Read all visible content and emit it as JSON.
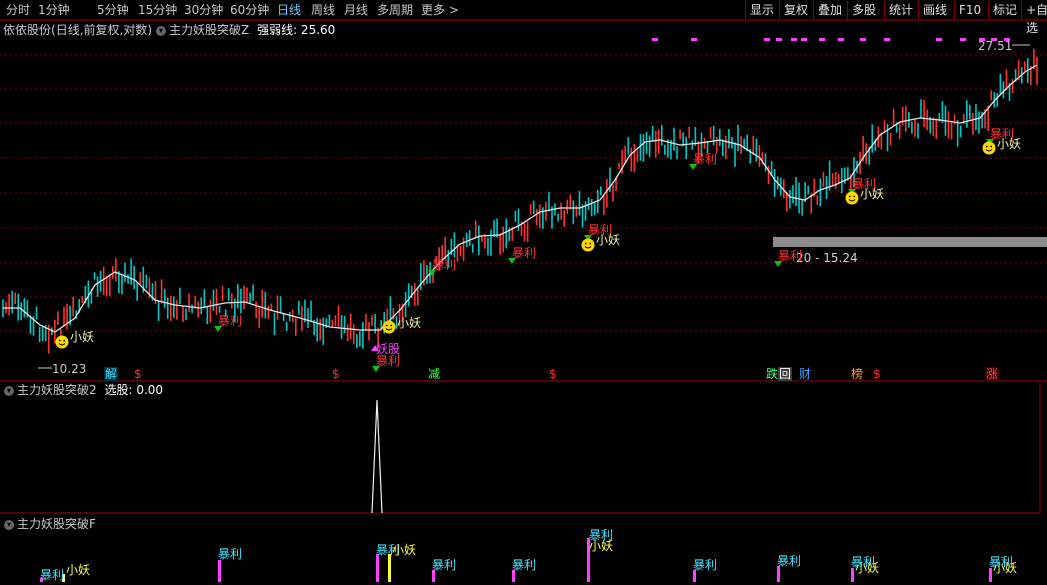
{
  "colors": {
    "up": "#ff3232",
    "down": "#00c8c8",
    "ma": "#e8e8e8",
    "grid": "#8a0000",
    "magenta": "#ff40ff",
    "yellow": "#ffff40",
    "cyan": "#40e0ff",
    "red_text": "#ff3030",
    "green_arrow": "#10c010"
  },
  "toolbar": {
    "period_tabs": [
      "分时",
      "1分钟",
      "5分钟",
      "15分钟",
      "30分钟",
      "60分钟",
      "日线",
      "周线",
      "月线",
      "多周期",
      "更多 >"
    ],
    "active_tab": "日线",
    "right_buttons": [
      "显示",
      "复权",
      "叠加",
      "多股",
      "统计",
      "画线",
      "F10",
      "标记",
      "+自选"
    ]
  },
  "main_pane": {
    "stock_name": "依依股份",
    "period_info": "(日线,前复权,对数)",
    "indicator_name": "主力妖股突破Z",
    "indicator_value_label": "强弱线: 25.60",
    "price_high": "27.51",
    "price_low": "10.23",
    "range_info": "20 - 15.24",
    "buy_label": "暴利",
    "demon_label": "小妖",
    "demon_stock_label": "妖股",
    "smiley_icon": "smiley-face-icon"
  },
  "event_badges": [
    {
      "text": "解",
      "color": "#40e0ff",
      "bg": "#003040"
    },
    {
      "text": "$",
      "color": "#ff3030",
      "bg": ""
    },
    {
      "text": "$",
      "color": "#ff3030",
      "bg": ""
    },
    {
      "text": "减",
      "color": "#40ff40",
      "bg": ""
    },
    {
      "text": "$",
      "color": "#ff3030",
      "bg": ""
    },
    {
      "text": "跌",
      "color": "#40ff80",
      "bg": ""
    },
    {
      "text": "回",
      "color": "#ffffff",
      "bg": "#3a3a3a"
    },
    {
      "text": "财",
      "color": "#40a0ff",
      "bg": ""
    },
    {
      "text": "榜",
      "color": "#ffa040",
      "bg": ""
    },
    {
      "text": "$",
      "color": "#ff3030",
      "bg": ""
    },
    {
      "text": "涨",
      "color": "#ff4040",
      "bg": "#3a0000"
    }
  ],
  "pane2": {
    "title": "主力妖股突破2",
    "value_label": "选股: 0.00"
  },
  "pane3": {
    "title": "主力妖股突破F"
  },
  "chart_data": {
    "type": "candlestick",
    "title": "依依股份",
    "ylim": [
      10.23,
      27.51
    ],
    "ma_name": "强弱线",
    "ma_last": 25.6,
    "signal_series": {
      "name": "选股",
      "last": 0.0,
      "peak": 1
    }
  }
}
